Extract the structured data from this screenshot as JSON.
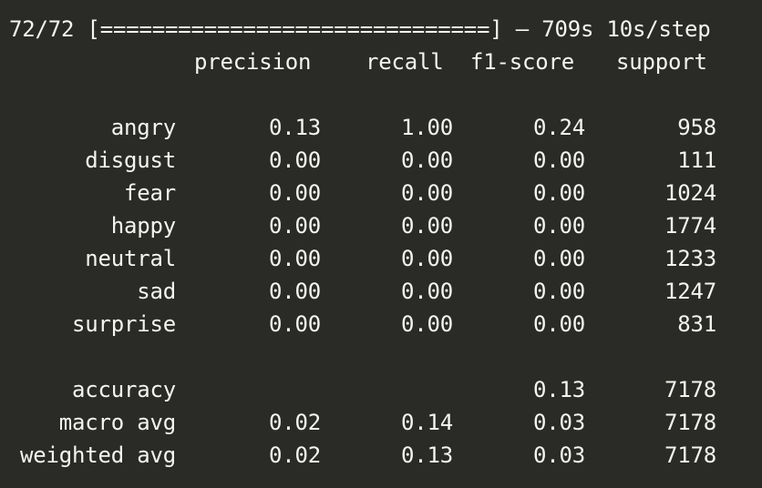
{
  "progress": {
    "counter": "72/72",
    "bar": "[==============================]",
    "dash": "–",
    "time": "709s",
    "per_step": "10s/step"
  },
  "header": {
    "precision": "precision",
    "recall": "recall",
    "f1": "f1-score",
    "support": "support"
  },
  "classes": [
    {
      "label": "angry",
      "precision": "0.13",
      "recall": "1.00",
      "f1": "0.24",
      "support": "958"
    },
    {
      "label": "disgust",
      "precision": "0.00",
      "recall": "0.00",
      "f1": "0.00",
      "support": "111"
    },
    {
      "label": "fear",
      "precision": "0.00",
      "recall": "0.00",
      "f1": "0.00",
      "support": "1024"
    },
    {
      "label": "happy",
      "precision": "0.00",
      "recall": "0.00",
      "f1": "0.00",
      "support": "1774"
    },
    {
      "label": "neutral",
      "precision": "0.00",
      "recall": "0.00",
      "f1": "0.00",
      "support": "1233"
    },
    {
      "label": "sad",
      "precision": "0.00",
      "recall": "0.00",
      "f1": "0.00",
      "support": "1247"
    },
    {
      "label": "surprise",
      "precision": "0.00",
      "recall": "0.00",
      "f1": "0.00",
      "support": "831"
    }
  ],
  "summary": [
    {
      "label": "accuracy",
      "precision": "",
      "recall": "",
      "f1": "0.13",
      "support": "7178"
    },
    {
      "label": "macro avg",
      "precision": "0.02",
      "recall": "0.14",
      "f1": "0.03",
      "support": "7178"
    },
    {
      "label": "weighted avg",
      "precision": "0.02",
      "recall": "0.13",
      "f1": "0.03",
      "support": "7178"
    }
  ],
  "colors": {
    "background": "#2a2b26",
    "text": "#f4f4f0"
  }
}
